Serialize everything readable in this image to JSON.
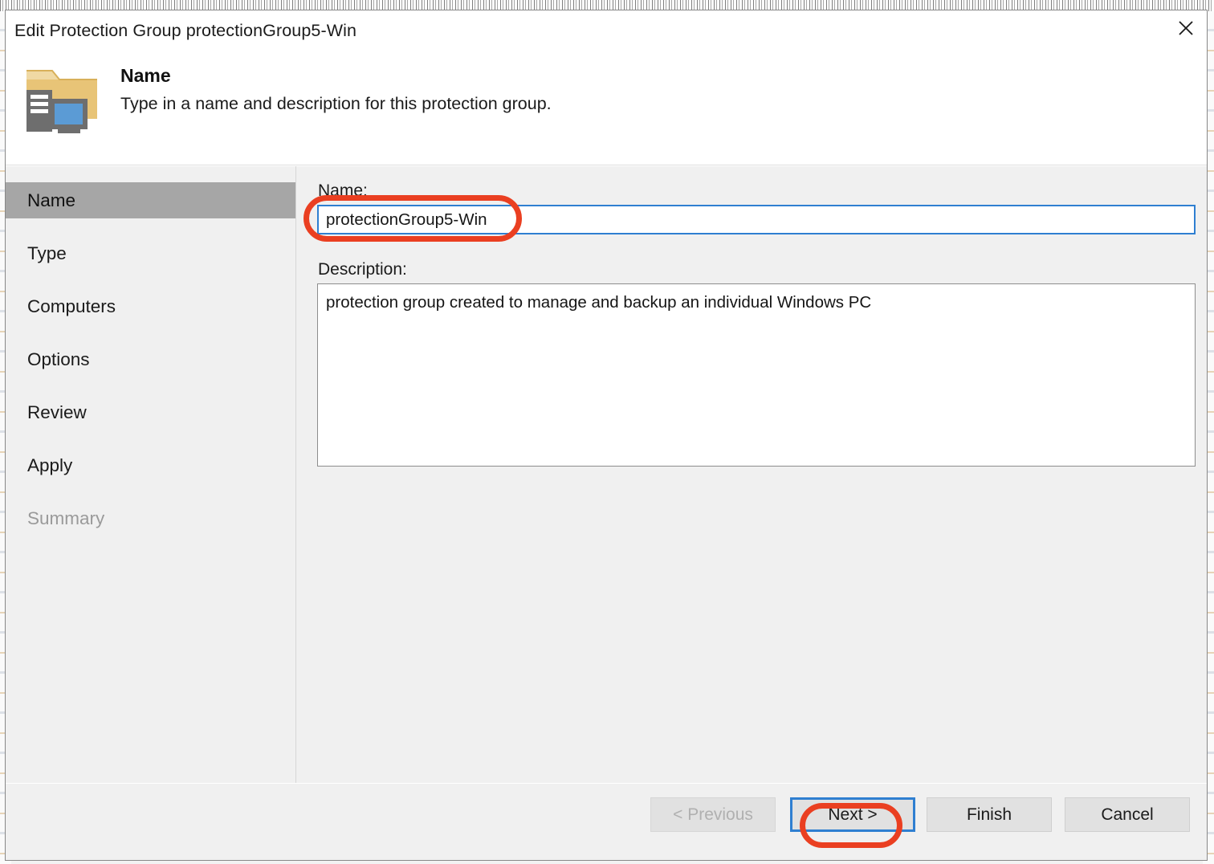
{
  "window": {
    "title": "Edit Protection Group protectionGroup5-Win",
    "close_icon": "close-icon"
  },
  "header": {
    "icon": "protection-group-folder-computer-icon",
    "title": "Name",
    "subtitle": "Type in a name and description for this protection group."
  },
  "sidebar": {
    "items": [
      {
        "label": "Name",
        "state": "selected"
      },
      {
        "label": "Type",
        "state": "enabled"
      },
      {
        "label": "Computers",
        "state": "enabled"
      },
      {
        "label": "Options",
        "state": "enabled"
      },
      {
        "label": "Review",
        "state": "enabled"
      },
      {
        "label": "Apply",
        "state": "enabled"
      },
      {
        "label": "Summary",
        "state": "disabled"
      }
    ]
  },
  "form": {
    "name_label": "Name:",
    "name_value": "protectionGroup5-Win",
    "name_placeholder": "",
    "description_label": "Description:",
    "description_value": "protection group created to manage and backup an individual Windows PC",
    "description_placeholder": ""
  },
  "footer": {
    "previous_label": "< Previous",
    "next_label": "Next >",
    "finish_label": "Finish",
    "cancel_label": "Cancel"
  },
  "annotations": {
    "color": "#ea3f21",
    "shapes": [
      {
        "name": "name-field-highlight",
        "target": "name-input"
      },
      {
        "name": "next-button-highlight",
        "target": "next-button"
      }
    ]
  },
  "colors": {
    "dialog_background": "#ffffff",
    "panel_background": "#f0f0f0",
    "selection": "#a6a6a6",
    "focus_blue": "#2f7fd1",
    "folder_yellow": "#e8c477",
    "computer_gray": "#6e6e6e",
    "monitor_blue": "#5b9bd5",
    "annotation_red": "#ea3f21"
  }
}
